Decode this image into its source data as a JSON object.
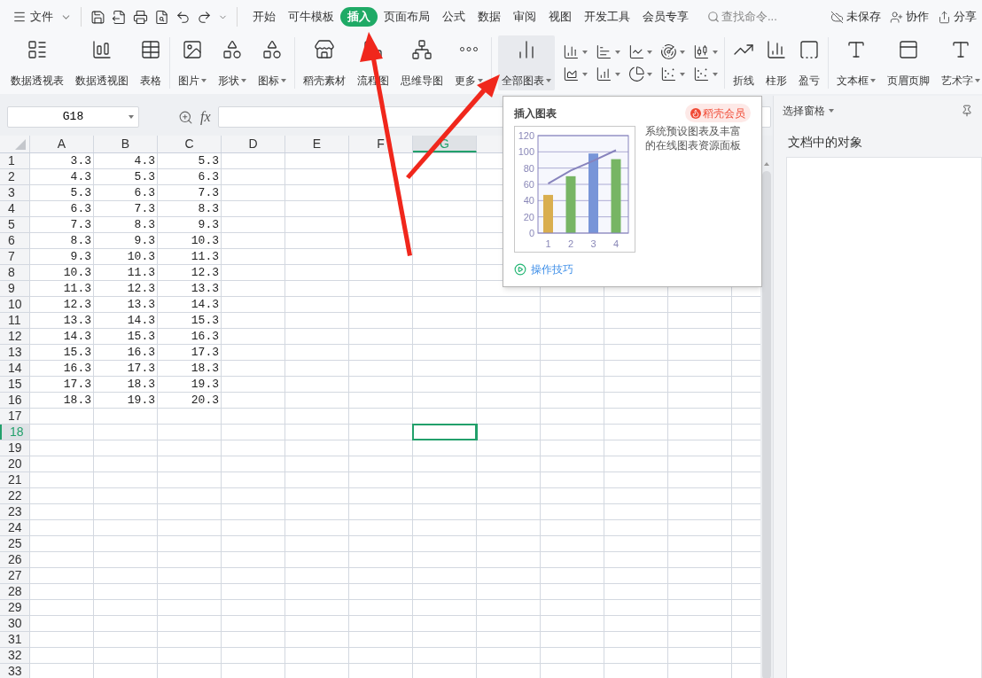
{
  "file_menu": {
    "label": "文件"
  },
  "tabs": [
    {
      "label": "开始",
      "selected": false
    },
    {
      "label": "可牛模板",
      "selected": false
    },
    {
      "label": "插入",
      "selected": true
    },
    {
      "label": "页面布局",
      "selected": false
    },
    {
      "label": "公式",
      "selected": false
    },
    {
      "label": "数据",
      "selected": false
    },
    {
      "label": "审阅",
      "selected": false
    },
    {
      "label": "视图",
      "selected": false
    },
    {
      "label": "开发工具",
      "selected": false
    },
    {
      "label": "会员专享",
      "selected": false
    }
  ],
  "search": {
    "placeholder": "查找命令..."
  },
  "header_actions": [
    {
      "label": "未保存"
    },
    {
      "label": "协作"
    },
    {
      "label": "分享"
    }
  ],
  "ribbon": {
    "groups": [
      {
        "kind": "buttons",
        "items": [
          {
            "label": "数据透视表",
            "dropdown": false,
            "selected": false
          },
          {
            "label": "数据透视图",
            "dropdown": false,
            "selected": false
          },
          {
            "label": "表格",
            "dropdown": false,
            "selected": false
          }
        ]
      },
      {
        "kind": "buttons",
        "items": [
          {
            "label": "图片",
            "dropdown": true,
            "selected": false
          },
          {
            "label": "形状",
            "dropdown": true,
            "selected": false
          },
          {
            "label": "图标",
            "dropdown": true,
            "selected": false
          }
        ]
      },
      {
        "kind": "buttons",
        "items": [
          {
            "label": "稻壳素材",
            "dropdown": false,
            "selected": false
          },
          {
            "label": "流程图",
            "dropdown": false,
            "selected": false
          },
          {
            "label": "思维导图",
            "dropdown": false,
            "selected": false
          },
          {
            "label": "更多",
            "dropdown": true,
            "selected": false
          }
        ]
      },
      {
        "kind": "charts",
        "items": [
          {
            "label": "全部图表",
            "dropdown": true,
            "selected": true
          }
        ]
      },
      {
        "kind": "buttons",
        "items": [
          {
            "label": "折线",
            "dropdown": false,
            "selected": false
          },
          {
            "label": "柱形",
            "dropdown": false,
            "selected": false
          },
          {
            "label": "盈亏",
            "dropdown": false,
            "selected": false
          }
        ]
      },
      {
        "kind": "buttons",
        "items": [
          {
            "label": "文本框",
            "dropdown": true,
            "selected": false
          },
          {
            "label": "页眉页脚",
            "dropdown": false,
            "selected": false
          },
          {
            "label": "艺术字",
            "dropdown": true,
            "selected": false
          }
        ]
      }
    ]
  },
  "name_box": {
    "value": "G18"
  },
  "formula_label": "fx",
  "sheet": {
    "columns": [
      {
        "label": "A",
        "selected": false
      },
      {
        "label": "B",
        "selected": false
      },
      {
        "label": "C",
        "selected": false
      },
      {
        "label": "D",
        "selected": false
      },
      {
        "label": "E",
        "selected": false
      },
      {
        "label": "F",
        "selected": false
      },
      {
        "label": "G",
        "selected": true
      }
    ],
    "rows": [
      {
        "label": "1",
        "selected": false,
        "cells": [
          "3.3",
          "4.3",
          "5.3"
        ]
      },
      {
        "label": "2",
        "selected": false,
        "cells": [
          "4.3",
          "5.3",
          "6.3"
        ]
      },
      {
        "label": "3",
        "selected": false,
        "cells": [
          "5.3",
          "6.3",
          "7.3"
        ]
      },
      {
        "label": "4",
        "selected": false,
        "cells": [
          "6.3",
          "7.3",
          "8.3"
        ]
      },
      {
        "label": "5",
        "selected": false,
        "cells": [
          "7.3",
          "8.3",
          "9.3"
        ]
      },
      {
        "label": "6",
        "selected": false,
        "cells": [
          "8.3",
          "9.3",
          "10.3"
        ]
      },
      {
        "label": "7",
        "selected": false,
        "cells": [
          "9.3",
          "10.3",
          "11.3"
        ]
      },
      {
        "label": "8",
        "selected": false,
        "cells": [
          "10.3",
          "11.3",
          "12.3"
        ]
      },
      {
        "label": "9",
        "selected": false,
        "cells": [
          "11.3",
          "12.3",
          "13.3"
        ]
      },
      {
        "label": "10",
        "selected": false,
        "cells": [
          "12.3",
          "13.3",
          "14.3"
        ]
      },
      {
        "label": "11",
        "selected": false,
        "cells": [
          "13.3",
          "14.3",
          "15.3"
        ]
      },
      {
        "label": "12",
        "selected": false,
        "cells": [
          "14.3",
          "15.3",
          "16.3"
        ]
      },
      {
        "label": "13",
        "selected": false,
        "cells": [
          "15.3",
          "16.3",
          "17.3"
        ]
      },
      {
        "label": "14",
        "selected": false,
        "cells": [
          "16.3",
          "17.3",
          "18.3"
        ]
      },
      {
        "label": "15",
        "selected": false,
        "cells": [
          "17.3",
          "18.3",
          "19.3"
        ]
      },
      {
        "label": "16",
        "selected": false,
        "cells": [
          "18.3",
          "19.3",
          "20.3"
        ]
      },
      {
        "label": "17",
        "selected": false
      },
      {
        "label": "18",
        "selected": true
      },
      {
        "label": "19",
        "selected": false
      },
      {
        "label": "20",
        "selected": false
      },
      {
        "label": "21",
        "selected": false
      },
      {
        "label": "22",
        "selected": false
      },
      {
        "label": "23",
        "selected": false
      },
      {
        "label": "24",
        "selected": false
      },
      {
        "label": "25",
        "selected": false
      },
      {
        "label": "26",
        "selected": false
      },
      {
        "label": "27",
        "selected": false
      },
      {
        "label": "28",
        "selected": false
      },
      {
        "label": "29",
        "selected": false
      },
      {
        "label": "30",
        "selected": false
      },
      {
        "label": "31",
        "selected": false
      },
      {
        "label": "32",
        "selected": false
      },
      {
        "label": "33",
        "selected": false
      }
    ]
  },
  "chart_popup": {
    "title": "插入图表",
    "badge": "稻壳会员",
    "description": "系统预设图表及丰富的在线图表资源面板",
    "link": "操作技巧",
    "chart_data": {
      "type": "bar",
      "categories": [
        "1",
        "2",
        "3",
        "4"
      ],
      "ylim": [
        0,
        120
      ],
      "yticks": [
        0,
        20,
        40,
        60,
        80,
        100,
        120
      ],
      "grid": true,
      "stacked": true,
      "series": [
        {
          "color": "#d9ae4f",
          "values": [
            47,
            null,
            null,
            null
          ]
        },
        {
          "color": "#77b564",
          "values": [
            null,
            70,
            null,
            91
          ]
        },
        {
          "color": "#7895d8",
          "values": [
            null,
            null,
            98,
            null
          ]
        },
        {
          "type": "line",
          "color": "#8783bd",
          "values": [
            61,
            77,
            89,
            102
          ]
        }
      ]
    }
  },
  "selection_pane": {
    "title": "选择窗格",
    "section": "文档中的对象"
  }
}
